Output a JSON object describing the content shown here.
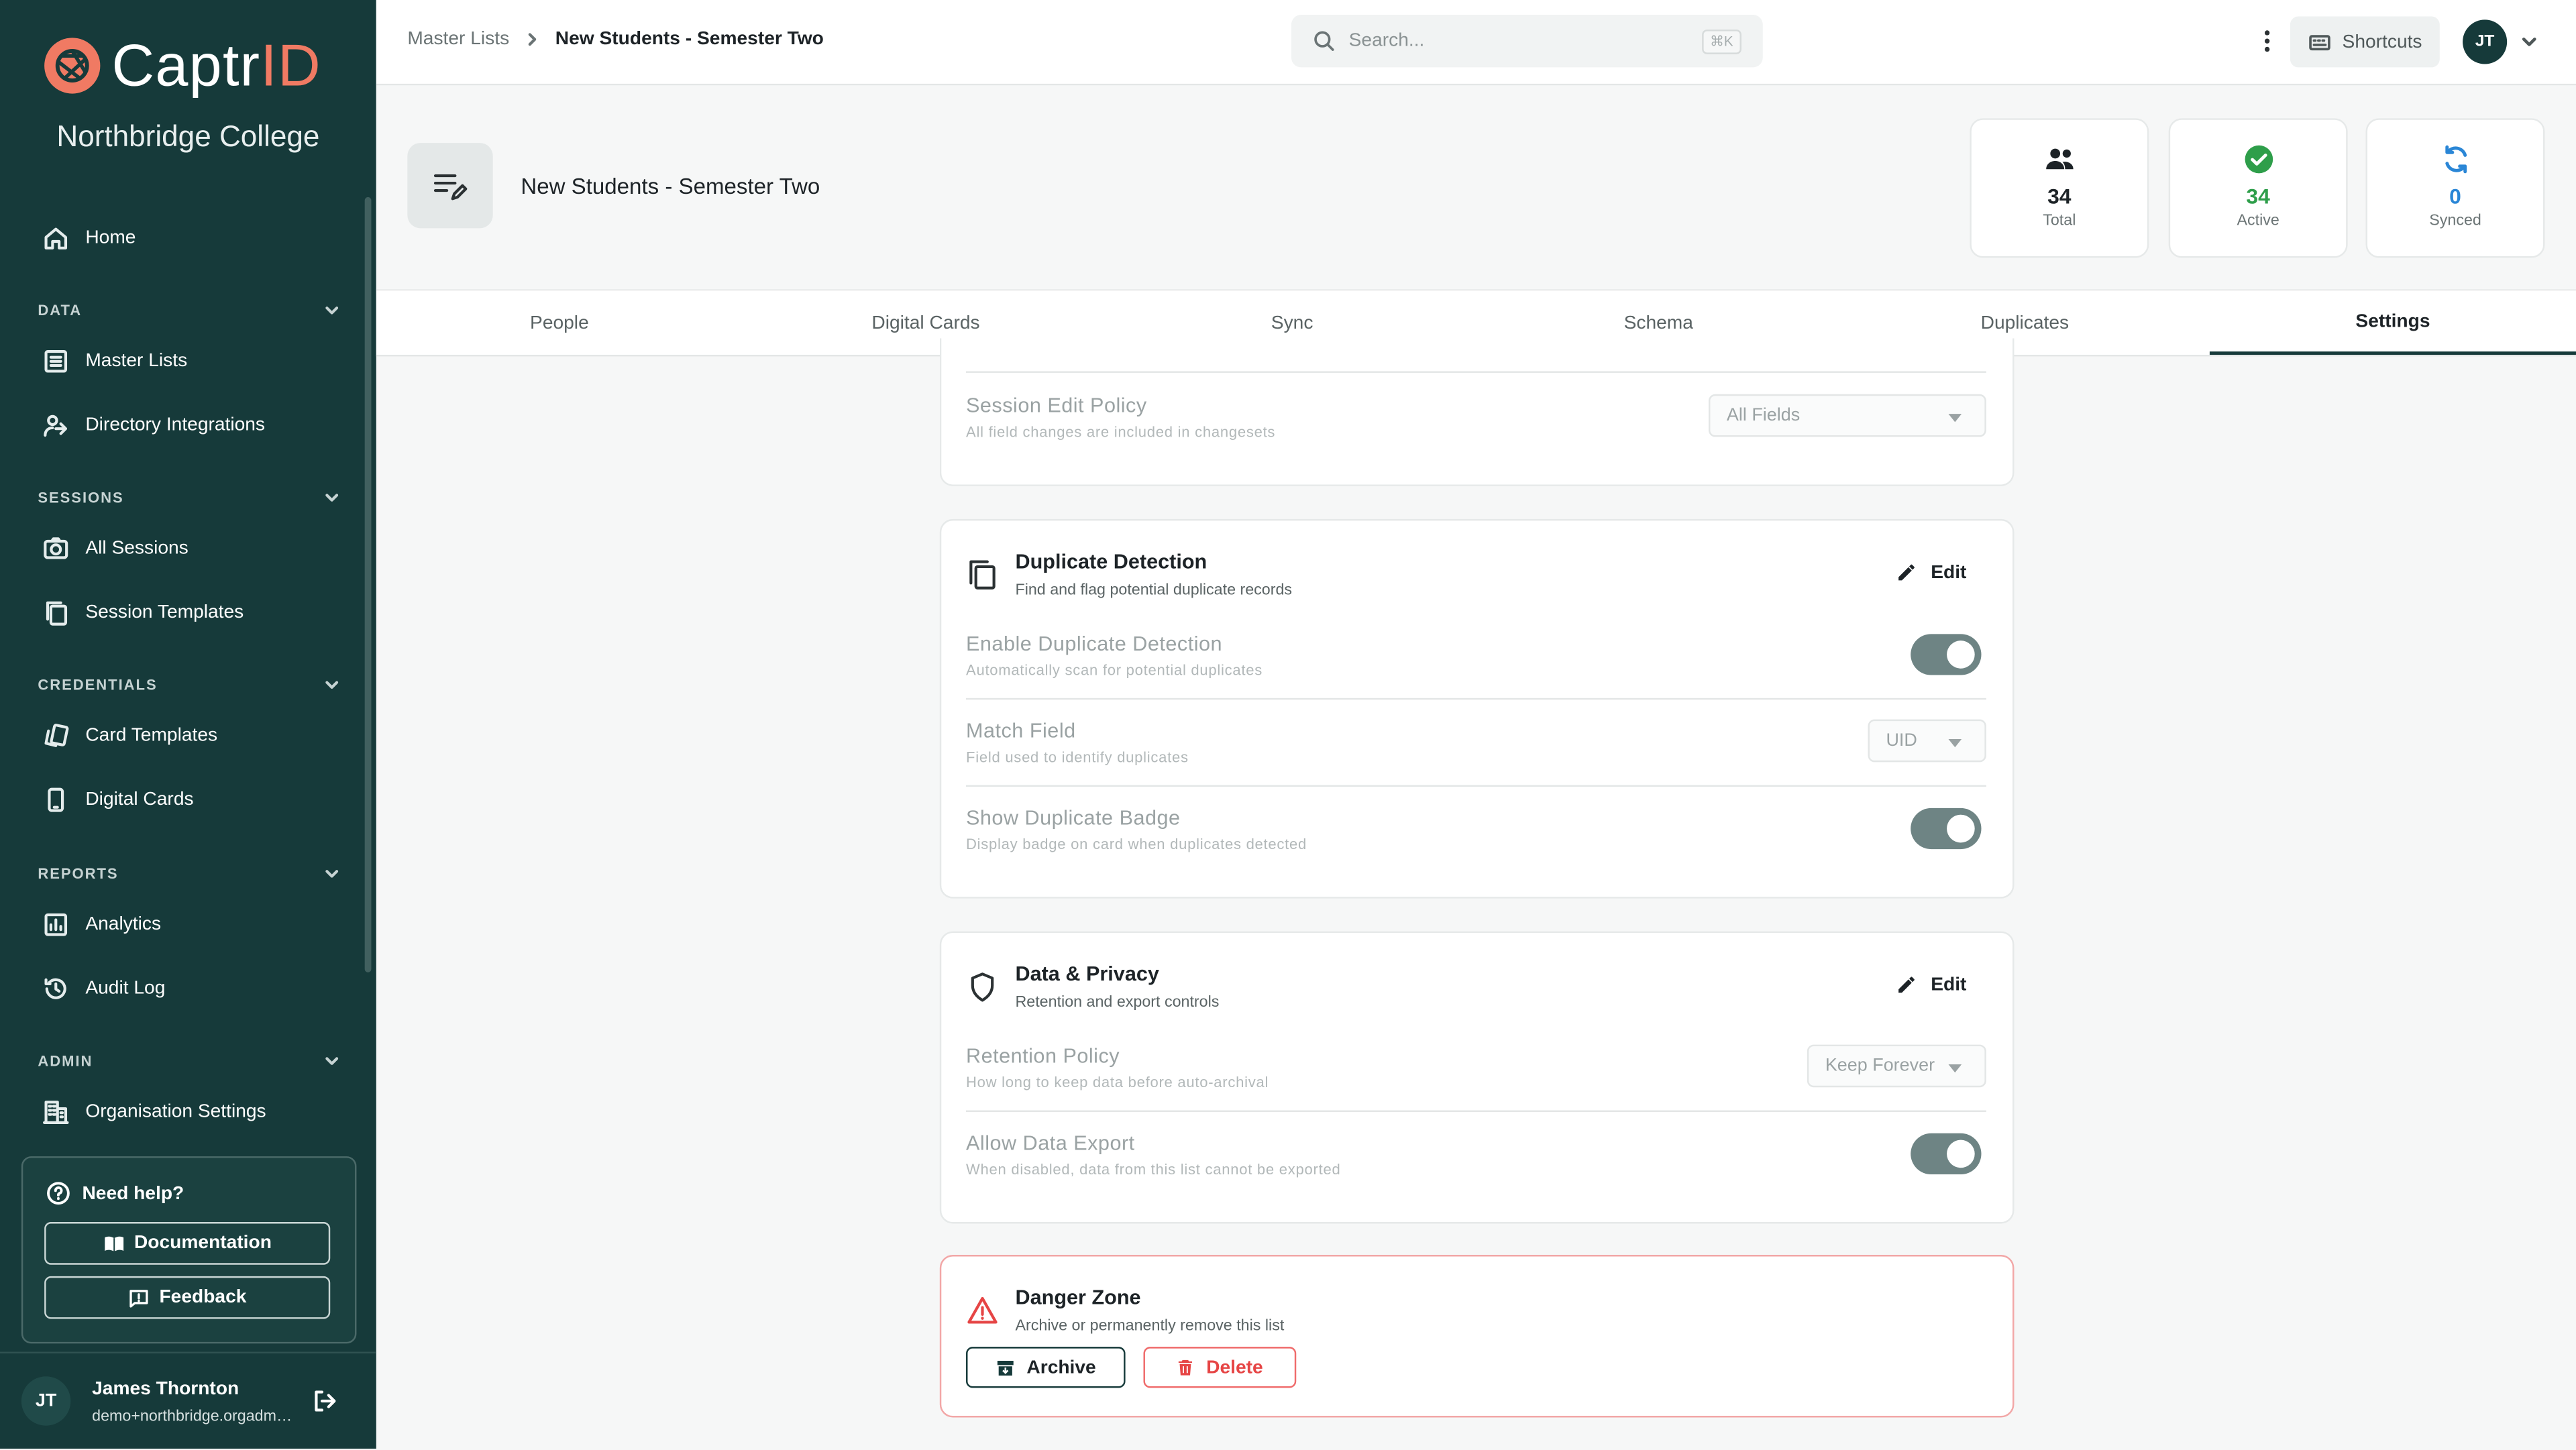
{
  "brand": {
    "name_main": "Captr",
    "name_accent": "ID",
    "org": "Northbridge College"
  },
  "sidebar": {
    "home": "Home",
    "sections": [
      {
        "label": "DATA",
        "items": [
          "Master Lists",
          "Directory Integrations"
        ]
      },
      {
        "label": "SESSIONS",
        "items": [
          "All Sessions",
          "Session Templates"
        ]
      },
      {
        "label": "CREDENTIALS",
        "items": [
          "Card Templates",
          "Digital Cards"
        ]
      },
      {
        "label": "REPORTS",
        "items": [
          "Analytics",
          "Audit Log"
        ]
      },
      {
        "label": "ADMIN",
        "items": [
          "Organisation Settings"
        ]
      }
    ],
    "help": {
      "title": "Need help?",
      "docs": "Documentation",
      "feedback": "Feedback"
    },
    "user": {
      "initials": "JT",
      "name": "James Thornton",
      "email": "demo+northbridge.orgadmin@captrid.com"
    }
  },
  "topbar": {
    "breadcrumb": [
      "Master Lists",
      "New Students - Semester Two"
    ],
    "search_placeholder": "Search...",
    "search_kbd": "⌘K",
    "shortcuts": "Shortcuts",
    "avatar": "JT"
  },
  "header": {
    "title": "New Students - Semester Two",
    "stats": [
      {
        "value": "34",
        "label": "Total",
        "color": "#1d2327"
      },
      {
        "value": "34",
        "label": "Active",
        "color": "#2e9e4a"
      },
      {
        "value": "0",
        "label": "Synced",
        "color": "#2a86d6"
      }
    ]
  },
  "tabs": [
    "People",
    "Digital Cards",
    "Sync",
    "Schema",
    "Duplicates",
    "Settings"
  ],
  "active_tab": "Settings",
  "settings": {
    "session": {
      "label": "Session Edit Policy",
      "desc": "All field changes are included in changesets",
      "value": "All Fields"
    },
    "duplicate": {
      "title": "Duplicate Detection",
      "subtitle": "Find and flag potential duplicate records",
      "edit": "Edit",
      "rows": [
        {
          "label": "Enable Duplicate Detection",
          "desc": "Automatically scan for potential duplicates",
          "enabled": true
        },
        {
          "label": "Match Field",
          "desc": "Field used to identify duplicates",
          "value": "UID"
        },
        {
          "label": "Show Duplicate Badge",
          "desc": "Display badge on card when duplicates detected",
          "enabled": true
        }
      ]
    },
    "privacy": {
      "title": "Data & Privacy",
      "subtitle": "Retention and export controls",
      "edit": "Edit",
      "rows": [
        {
          "label": "Retention Policy",
          "desc": "How long to keep data before auto-archival",
          "value": "Keep Forever"
        },
        {
          "label": "Allow Data Export",
          "desc": "When disabled, data from this list cannot be exported",
          "enabled": true
        }
      ]
    },
    "danger": {
      "title": "Danger Zone",
      "subtitle": "Archive or permanently remove this list",
      "archive": "Archive",
      "delete": "Delete"
    }
  },
  "colors": {
    "sidebar": "#163a3a",
    "accent": "#f07a63",
    "danger": "#e64545"
  }
}
